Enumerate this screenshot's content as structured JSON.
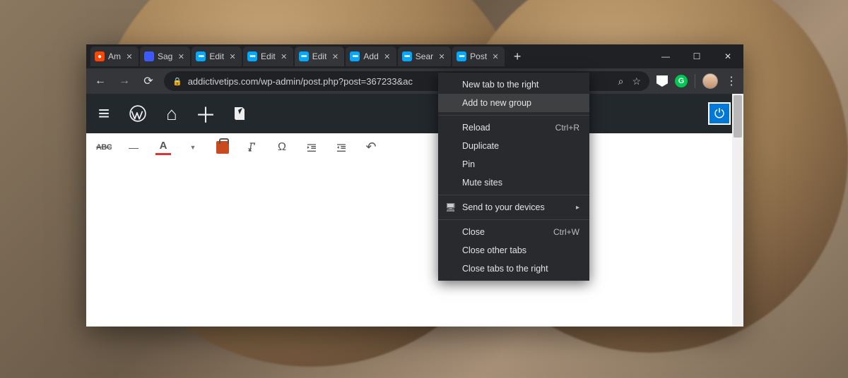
{
  "window": {
    "minimize_symbol": "—",
    "maximize_symbol": "☐",
    "close_symbol": "✕"
  },
  "tabs": [
    {
      "title": "Am",
      "favicon": "reddit"
    },
    {
      "title": "Sag",
      "favicon": "sage"
    },
    {
      "title": "Edit",
      "favicon": "at"
    },
    {
      "title": "Edit",
      "favicon": "at"
    },
    {
      "title": "Edit",
      "favicon": "at"
    },
    {
      "title": "Add",
      "favicon": "at"
    },
    {
      "title": "Sear",
      "favicon": "at"
    },
    {
      "title": "Post",
      "favicon": "at"
    }
  ],
  "new_tab_symbol": "+",
  "address": {
    "url": "addictivetips.com/wp-admin/post.php?post=367233&ac",
    "search_icon": "⌕",
    "star_icon": "☆"
  },
  "context_menu": {
    "items": [
      {
        "label": "New tab to the right"
      },
      {
        "label": "Add to new group",
        "hover": true
      }
    ],
    "items2": [
      {
        "label": "Reload",
        "shortcut": "Ctrl+R"
      },
      {
        "label": "Duplicate"
      },
      {
        "label": "Pin"
      },
      {
        "label": "Mute sites"
      }
    ],
    "items3": [
      {
        "label": "Send to your devices",
        "submenu": true,
        "icon": "devices"
      }
    ],
    "items4": [
      {
        "label": "Close",
        "shortcut": "Ctrl+W"
      },
      {
        "label": "Close other tabs"
      },
      {
        "label": "Close tabs to the right"
      }
    ]
  },
  "editor_toolbar": {
    "abc": "ABC",
    "A": "A",
    "omega": "Ω"
  },
  "icons": {
    "tab_close": "✕",
    "back": "←",
    "forward": "→",
    "reload": "⟳",
    "lock": "🔒",
    "menu_dots": "⋮",
    "hamburger": "≡",
    "home": "⌂",
    "plus": "＋",
    "power": "⏻",
    "undo": "↶",
    "outdent": "⇤",
    "indent": "⇥",
    "tag": "⬣",
    "dash": "—",
    "caret": "▼",
    "sub_arrow": "▸",
    "devices": "🖥"
  }
}
